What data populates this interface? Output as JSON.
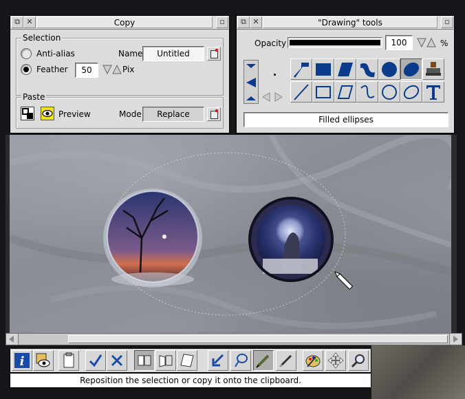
{
  "copy_window": {
    "title": "Copy",
    "selection": {
      "group_label": "Selection",
      "anti_alias_label": "Anti-alias",
      "feather_label": "Feather",
      "feather_value": "50",
      "feather_unit": "Pix",
      "name_label": "Name",
      "name_value": "Untitled"
    },
    "paste": {
      "group_label": "Paste",
      "preview_label": "Preview",
      "mode_label": "Mode",
      "mode_value": "Replace"
    }
  },
  "drawing_window": {
    "title": "\"Drawing\" tools",
    "opacity_label": "Opacity",
    "opacity_value": "100",
    "opacity_unit": "%",
    "status_text": "Filled ellipses",
    "tools": [
      "filled-line-tool",
      "filled-rectangle-tool",
      "filled-parallelogram-tool",
      "filled-curve-tool",
      "filled-circle-tool",
      "filled-ellipse-tool",
      "stamp-tool",
      "line-tool",
      "rectangle-tool",
      "parallelogram-tool",
      "curve-tool",
      "circle-tool",
      "ellipse-tool",
      "text-tool"
    ],
    "selected_tool": "filled-ellipse-tool"
  },
  "toolbar": {
    "buttons": [
      "info-icon",
      "view-icon",
      "clipboard-icon",
      "tick-icon",
      "cross-icon",
      "copy-mode-1-icon",
      "copy-mode-2-icon",
      "copy-mode-3-icon",
      "arrow-icon",
      "lasso-icon",
      "pencil-icon",
      "brush-icon",
      "palette-icon",
      "move-icon",
      "magnifier-icon"
    ],
    "status_text": "Reposition the selection or copy it onto the clipboard."
  },
  "colors": {
    "window_bg": "#dcdcdc",
    "tool_blue": "#0b3c8c",
    "preview_yellow": "#f0e020"
  }
}
